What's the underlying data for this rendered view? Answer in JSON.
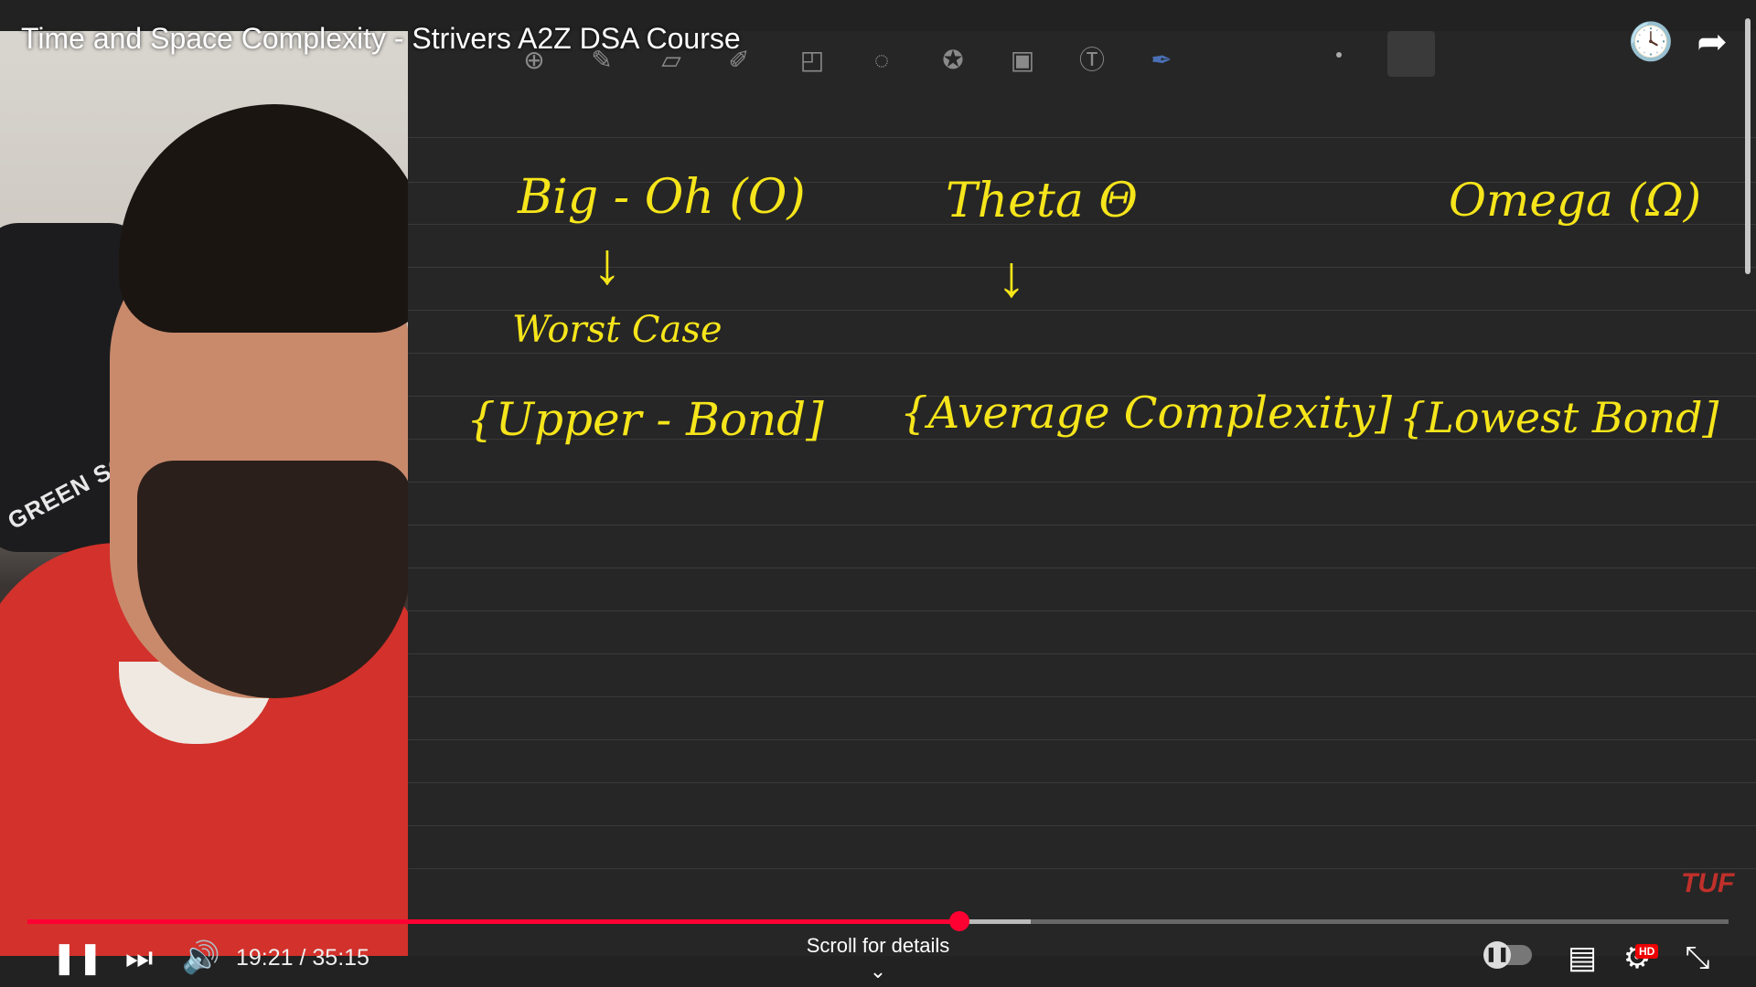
{
  "video": {
    "title": "Time and Space Complexity - Strivers A2Z DSA Course",
    "channel_watermark": "TUF",
    "chair_brand": "GREEN SOUL"
  },
  "board": {
    "notations": [
      {
        "name": "big-oh",
        "heading": "Big - Oh (O)",
        "arrow": "↓",
        "meaning": "Worst Case",
        "bracket": "{Upper - Bond]"
      },
      {
        "name": "theta",
        "heading": "Theta Θ",
        "arrow": "↓",
        "meaning": "",
        "bracket": "{Average Complexity]"
      },
      {
        "name": "omega",
        "heading": "Omega (Ω)",
        "arrow": "",
        "meaning": "",
        "bracket": "{Lowest Bond]"
      }
    ]
  },
  "app_toolbar": {
    "tools": [
      "zoom-icon",
      "pen-icon",
      "eraser-icon",
      "highlighter-icon",
      "shapes-icon",
      "lasso-icon",
      "sticker-icon",
      "image-icon",
      "text-icon",
      "pen-active-icon"
    ]
  },
  "top_icons": [
    "watch-later-icon",
    "share-icon"
  ],
  "player": {
    "current_time": "19:21",
    "duration": "35:15",
    "time_display": "19:21 / 35:15",
    "played_fraction": 0.548,
    "buffered_fraction": 0.59,
    "scroll_hint": "Scroll for details",
    "quality_badge": "HD",
    "accent": "#ff0033"
  }
}
